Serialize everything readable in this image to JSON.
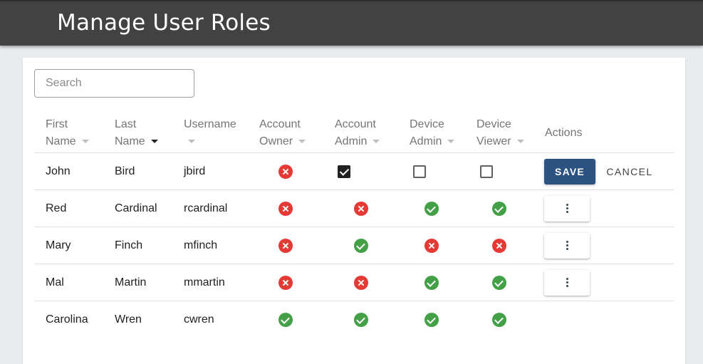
{
  "header": {
    "title": "Manage User Roles"
  },
  "search": {
    "placeholder": "Search",
    "value": ""
  },
  "columns": {
    "first_name": [
      "First",
      "Name"
    ],
    "last_name": [
      "Last",
      "Name"
    ],
    "username": [
      "Username"
    ],
    "account_owner": [
      "Account",
      "Owner"
    ],
    "account_admin": [
      "Account",
      "Admin"
    ],
    "device_admin": [
      "Device",
      "Admin"
    ],
    "device_viewer": [
      "Device",
      "Viewer"
    ],
    "actions": "Actions"
  },
  "actions": {
    "save_label": "SAVE",
    "cancel_label": "CANCEL"
  },
  "rows": [
    {
      "first": "John",
      "last": "Bird",
      "username": "jbird",
      "editing": true,
      "account_owner": false,
      "account_admin": true,
      "device_admin": false,
      "device_viewer": false
    },
    {
      "first": "Red",
      "last": "Cardinal",
      "username": "rcardinal",
      "account_owner": false,
      "account_admin": false,
      "device_admin": true,
      "device_viewer": true
    },
    {
      "first": "Mary",
      "last": "Finch",
      "username": "mfinch",
      "account_owner": false,
      "account_admin": true,
      "device_admin": false,
      "device_viewer": false
    },
    {
      "first": "Mal",
      "last": "Martin",
      "username": "mmartin",
      "account_owner": false,
      "account_admin": false,
      "device_admin": true,
      "device_viewer": true
    },
    {
      "first": "Carolina",
      "last": "Wren",
      "username": "cwren",
      "account_owner": true,
      "account_admin": true,
      "device_admin": true,
      "device_viewer": true
    }
  ]
}
